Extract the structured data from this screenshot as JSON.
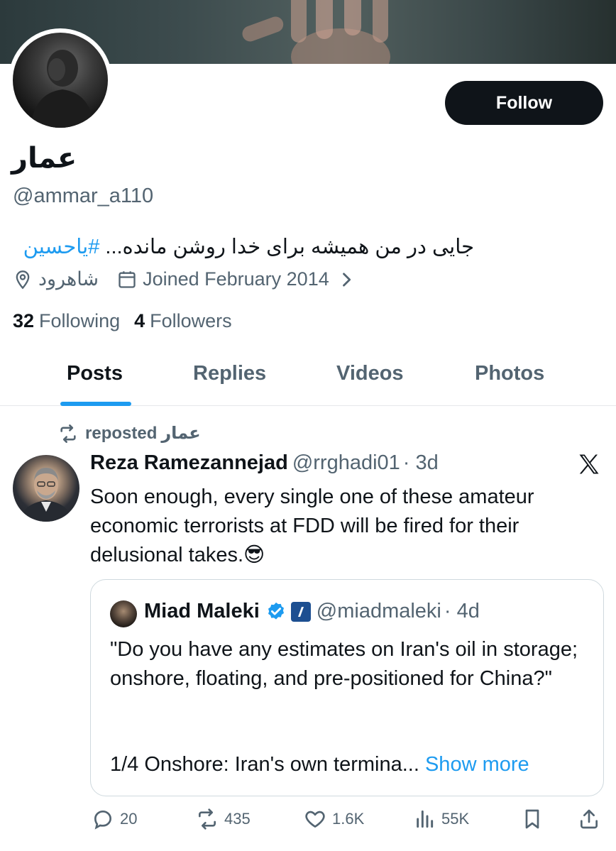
{
  "profile": {
    "name": "عمار",
    "handle": "@ammar_a110",
    "follow_label": "Follow",
    "bio_text": "جایی در من همیشه برای خدا روشن مانده... ",
    "bio_hashtag": "#یاحسین",
    "location": "شاهرود",
    "joined": "Joined February 2014",
    "following_count": "32",
    "following_label": "Following",
    "followers_count": "4",
    "followers_label": "Followers"
  },
  "tabs": [
    {
      "label": "Posts",
      "active": true
    },
    {
      "label": "Replies",
      "active": false
    },
    {
      "label": "Videos",
      "active": false
    },
    {
      "label": "Photos",
      "active": false
    }
  ],
  "post": {
    "repost_label": "reposted",
    "repost_by": "عمار",
    "author_name": "Reza Ramezannejad",
    "author_handle": "@rrghadi01",
    "time": "· 3d",
    "text": "Soon enough, every single one of these amateur economic terrorists at FDD will be fired for their delusional takes.",
    "emoji": "😎",
    "quote": {
      "author_name": "Miad Maleki",
      "author_handle": "@miadmaleki",
      "time": "· 4d",
      "text": "\"Do you have any estimates on Iran's oil in storage; onshore, floating, and pre-positioned for China?\"",
      "text2": "1/4 Onshore: Iran's own termina... ",
      "show_more": "Show more"
    },
    "stats": {
      "replies": "20",
      "reposts": "435",
      "likes": "1.6K",
      "views": "55K"
    }
  },
  "colors": {
    "accent": "#1d9bf0",
    "text": "#0f1419",
    "muted": "#536471"
  }
}
